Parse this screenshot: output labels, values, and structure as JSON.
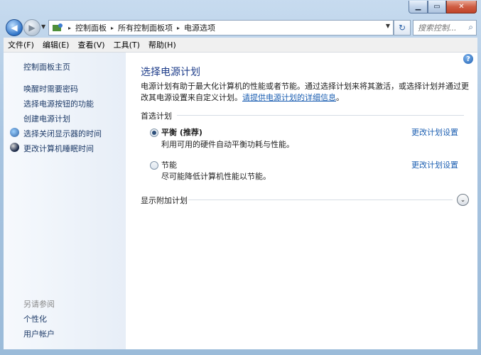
{
  "window": {
    "caption_buttons": [
      "minimize",
      "maximize",
      "close"
    ]
  },
  "nav": {
    "back_icon": "arrow-left-icon",
    "forward_icon": "arrow-right-icon",
    "breadcrumb": [
      "控制面板",
      "所有控制面板项",
      "电源选项"
    ],
    "search_placeholder": "搜索控制..."
  },
  "menubar": {
    "items": [
      "文件(F)",
      "编辑(E)",
      "查看(V)",
      "工具(T)",
      "帮助(H)"
    ]
  },
  "sidebar": {
    "home": "控制面板主页",
    "links": [
      "唤醒时需要密码",
      "选择电源按钮的功能",
      "创建电源计划",
      "选择关闭显示器的时间",
      "更改计算机睡眠时间"
    ],
    "see_also_heading": "另请参阅",
    "see_also": [
      "个性化",
      "用户帐户"
    ]
  },
  "main": {
    "title": "选择电源计划",
    "description": "电源计划有助于最大化计算机的性能或者节能。通过选择计划来将其激活，或选择计划并通过更改其电源设置来自定义计划。",
    "description_link": "请提供电源计划的详细信息",
    "description_end": "。",
    "preferred_heading": "首选计划",
    "plans": [
      {
        "name": "平衡 (推荐)",
        "desc": "利用可用的硬件自动平衡功耗与性能。",
        "link": "更改计划设置",
        "selected": true
      },
      {
        "name": "节能",
        "desc": "尽可能降低计算机性能以节能。",
        "link": "更改计划设置",
        "selected": false
      }
    ],
    "additional_heading": "显示附加计划"
  }
}
